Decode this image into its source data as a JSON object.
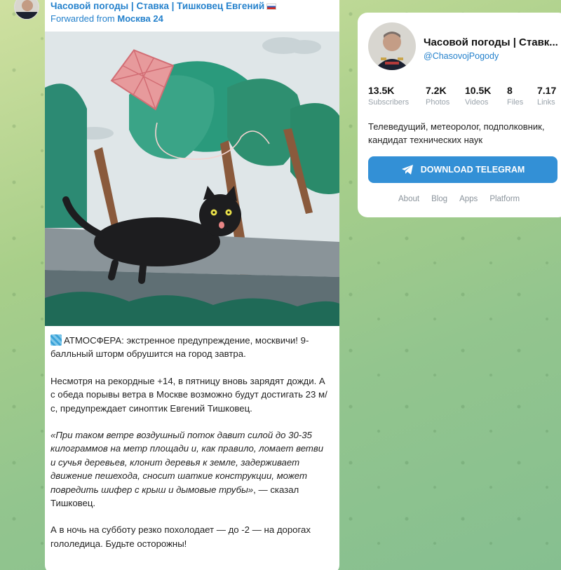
{
  "post": {
    "channel_name": "Часовой погоды | Ставка | Тишковец Евгений",
    "forwarded_prefix": "Forwarded from",
    "forwarded_source": "Москва 24",
    "paragraphs": {
      "p1": "АТМОСФЕРА: экстренное предупреждение, москвичи! 9-балльный шторм обрушится на город завтра.",
      "p2": "Несмотря на рекордные +14, в пятницу вновь зарядят дожди. А с обеда порывы ветра в Москве возможно будут достигать 23 м/с, предупреждает синоптик Евгений Тишковец.",
      "p3_italic": "«При таком ветре воздушный поток давит силой до 30-35 килограммов на метр площади и, как правило, ломает ветви и сучья деревьев, клонит деревья к земле, задерживает движение пешехода, сносит шаткие конструкции, может повредить шифер с крыш и дымовые трубы»",
      "p3_rest": ", — сказал Тишковец.",
      "p4": "А в ночь на субботу резко похолодает — до -2 — на дорогах гололедица. Будьте осторожны!"
    }
  },
  "card": {
    "title": "Часовой погоды | Ставк...",
    "handle": "@ChasovojPogody",
    "stats": [
      {
        "value": "13.5K",
        "label": "Subscribers"
      },
      {
        "value": "7.2K",
        "label": "Photos"
      },
      {
        "value": "10.5K",
        "label": "Videos"
      },
      {
        "value": "8",
        "label": "Files"
      },
      {
        "value": "7.17",
        "label": "Links"
      }
    ],
    "description": "Телеведущий, метеоролог, подполковник, кандидат технических наук",
    "download_label": "DOWNLOAD TELEGRAM",
    "links": [
      "About",
      "Blog",
      "Apps",
      "Platform"
    ]
  },
  "colors": {
    "accent": "#2481cc",
    "button": "#3390d6"
  }
}
